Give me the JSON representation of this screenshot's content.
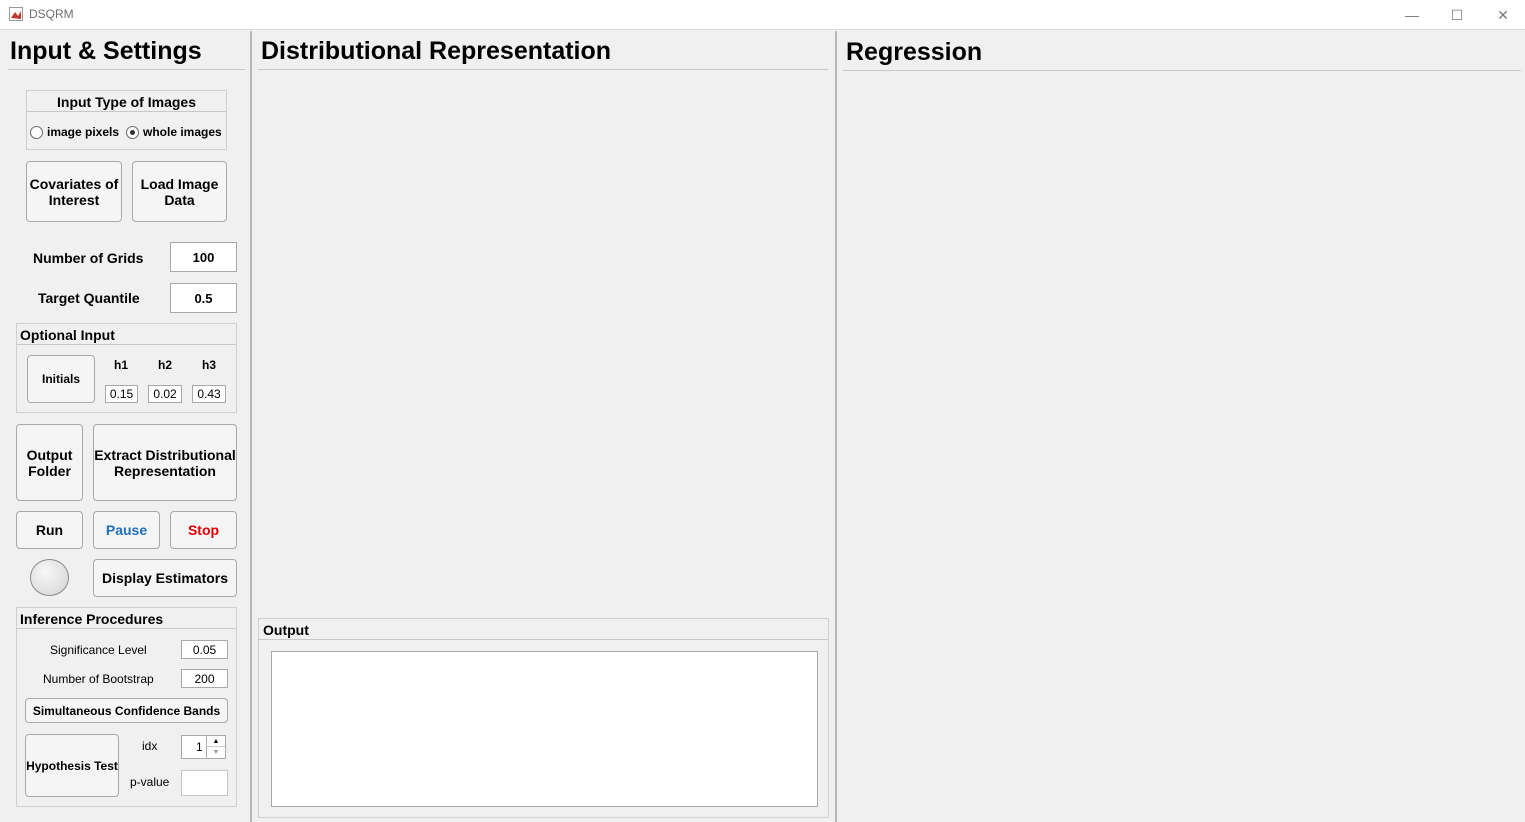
{
  "window": {
    "title": "DSQRM",
    "minimize_glyph": "—",
    "maximize_glyph": "☐",
    "close_glyph": "✕"
  },
  "left": {
    "title": "Input & Settings",
    "input_type": {
      "title": "Input Type of Images",
      "options": [
        "image pixels",
        "whole images"
      ],
      "selected": "whole images"
    },
    "covariates_label": "Covariates of Interest",
    "load_label": "Load Image Data",
    "num_grids_label": "Number of Grids",
    "num_grids_value": "100",
    "target_quantile_label": "Target Quantile",
    "target_quantile_value": "0.5",
    "optional": {
      "title": "Optional Input",
      "initials_label": "Initials",
      "h1_label": "h1",
      "h2_label": "h2",
      "h3_label": "h3",
      "h1_value": "0.15",
      "h2_value": "0.02",
      "h3_value": "0.43"
    },
    "output_folder_label": "Output Folder",
    "extract_label": "Extract Distributional Representation",
    "run_label": "Run",
    "pause_label": "Pause",
    "stop_label": "Stop",
    "display_label": "Display Estimators",
    "inference": {
      "title": "Inference Procedures",
      "significance_label": "Significance Level",
      "significance_value": "0.05",
      "bootstrap_label": "Number of Bootstrap",
      "bootstrap_value": "200",
      "bands_label": "Simultaneous Confidence Bands",
      "hypothesis_label": "Hypothesis Test",
      "idx_label": "idx",
      "idx_value": "1",
      "pvalue_label": "p-value",
      "pvalue_value": ""
    }
  },
  "middle": {
    "title": "Distributional Representation",
    "output_title": "Output",
    "output_text": ""
  },
  "right": {
    "title": "Regression"
  },
  "colors": {
    "pause": "#1f6fb5",
    "stop": "#e00000"
  }
}
